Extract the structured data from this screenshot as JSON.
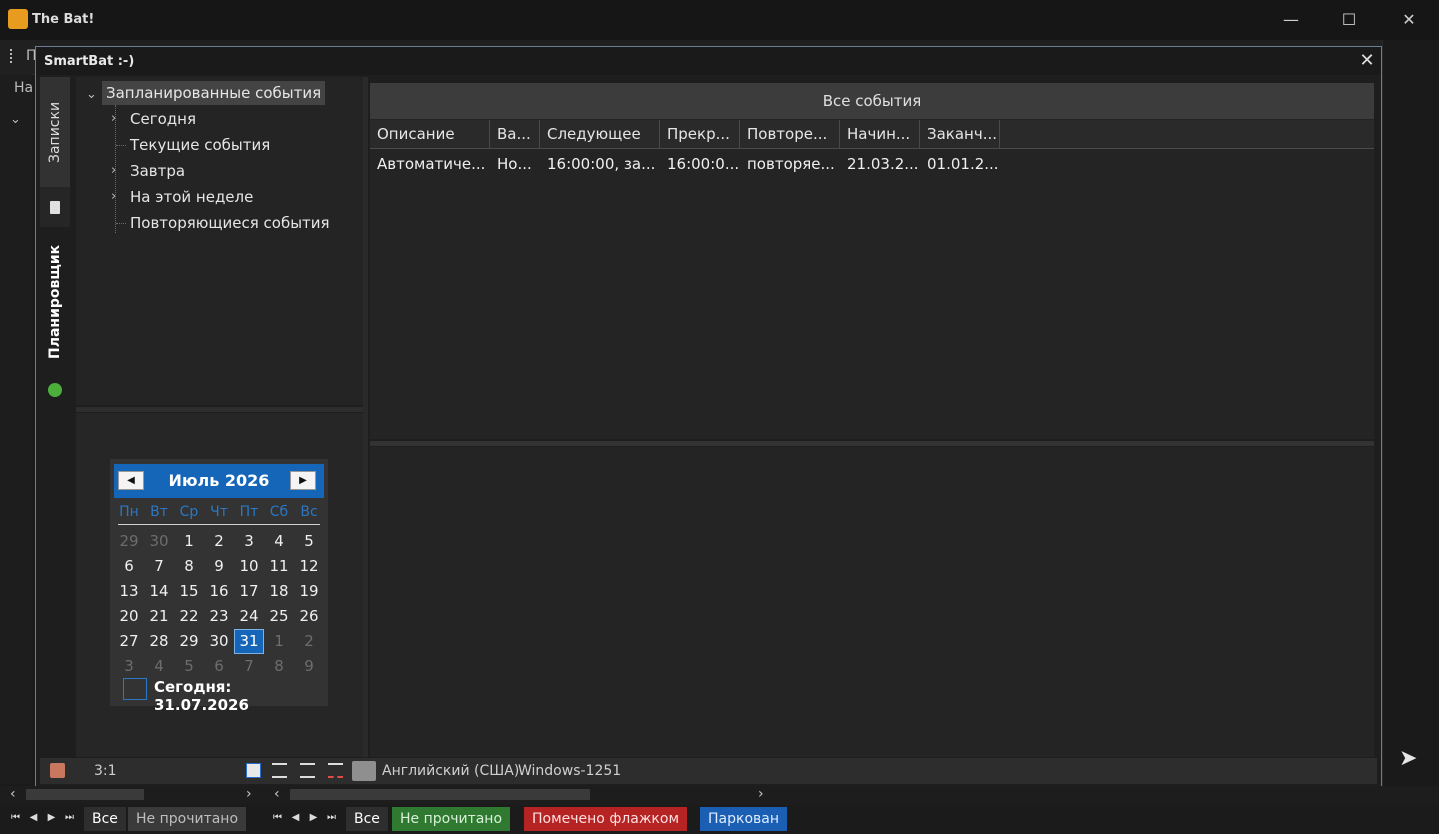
{
  "app": {
    "title": "The Bat!",
    "toolbar_fragment": "П",
    "left_fragment": "На"
  },
  "window_controls": {
    "minimize": "—",
    "maximize": "☐",
    "close": "✕"
  },
  "dialog": {
    "title": "SmartBat :-)",
    "close": "✕"
  },
  "side_tabs": {
    "notes": "Записки",
    "scheduler": "Планировщик"
  },
  "tree": {
    "root": "Запланированные события",
    "items": [
      {
        "label": "Сегодня",
        "expandable": true
      },
      {
        "label": "Текущие события",
        "expandable": false
      },
      {
        "label": "Завтра",
        "expandable": true
      },
      {
        "label": "На этой неделе",
        "expandable": true
      },
      {
        "label": "Повторяющиеся события",
        "expandable": false
      }
    ]
  },
  "calendar": {
    "month_label": "Июль 2026",
    "prev": "◀",
    "next": "▶",
    "weekdays": [
      "Пн",
      "Вт",
      "Ср",
      "Чт",
      "Пт",
      "Сб",
      "Вс"
    ],
    "weeks": [
      [
        "29",
        "30",
        "1",
        "2",
        "3",
        "4",
        "5"
      ],
      [
        "6",
        "7",
        "8",
        "9",
        "10",
        "11",
        "12"
      ],
      [
        "13",
        "14",
        "15",
        "16",
        "17",
        "18",
        "19"
      ],
      [
        "20",
        "21",
        "22",
        "23",
        "24",
        "25",
        "26"
      ],
      [
        "27",
        "28",
        "29",
        "30",
        "31",
        "1",
        "2"
      ],
      [
        "3",
        "4",
        "5",
        "6",
        "7",
        "8",
        "9"
      ]
    ],
    "selected_day": "31",
    "today_label": "Сегодня: 31.07.2026"
  },
  "events": {
    "title": "Все события",
    "columns": [
      "Описание",
      "Ва...",
      "Следующее",
      "Прекр...",
      "Повторе...",
      "Начин...",
      "Заканч..."
    ],
    "rows": [
      [
        "Автоматиче...",
        "Но...",
        "16:00:00, за...",
        "16:00:0...",
        "повторяе...",
        "21.03.2...",
        "01.01.2..."
      ]
    ]
  },
  "status_bar": {
    "position": "3:1",
    "language": "Английский (США)",
    "encoding": "Windows-1251"
  },
  "bottom_tabs": {
    "left": [
      "Все",
      "Не прочитано"
    ],
    "right": [
      "Все",
      "Не прочитано",
      "Помечено флажком",
      "Паркован"
    ]
  }
}
